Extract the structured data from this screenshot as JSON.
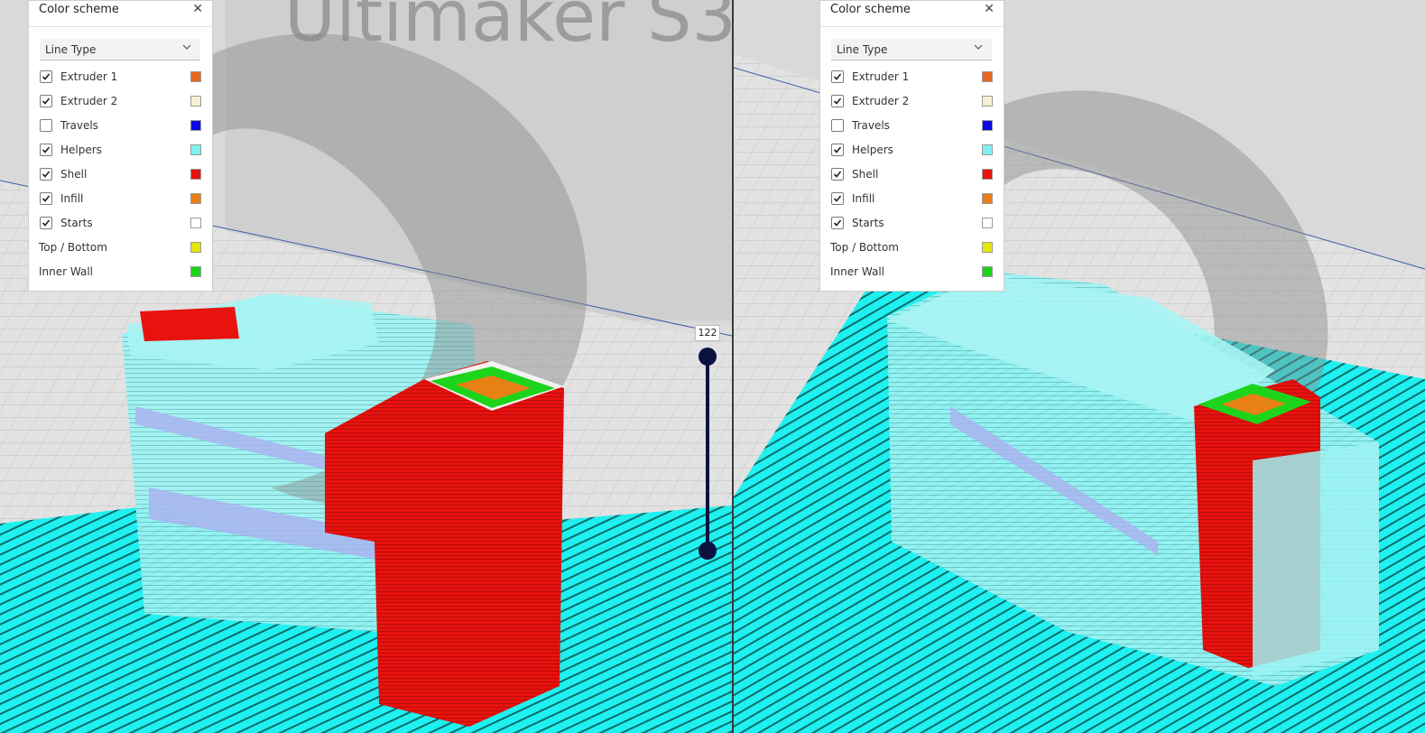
{
  "colors": {
    "panel_bg": "#ffffff",
    "slider": "#0c1240",
    "helpers": "#7ff0f0",
    "shell": "#e8120f",
    "inner_wall": "#1cd41c",
    "infill": "#e88016",
    "floor": "#e2e2e2"
  },
  "left": {
    "scene_brand": "Ultimaker S3",
    "panel": {
      "title": "Color scheme",
      "close_glyph": "✕",
      "dropdown_value": "Line Type",
      "rows": [
        {
          "label": "Extruder 1",
          "checked": true,
          "color": "#e8661e"
        },
        {
          "label": "Extruder 2",
          "checked": true,
          "color": "#f5f0d0"
        },
        {
          "label": "Travels",
          "checked": false,
          "color": "#0a0ae8"
        },
        {
          "label": "Helpers",
          "checked": true,
          "color": "#7ff0f0"
        },
        {
          "label": "Shell",
          "checked": true,
          "color": "#e8120f"
        },
        {
          "label": "Infill",
          "checked": true,
          "color": "#e88016"
        },
        {
          "label": "Starts",
          "checked": true,
          "color": "#ffffff"
        },
        {
          "label": "Top / Bottom",
          "checked": null,
          "color": "#e6e60c"
        },
        {
          "label": "Inner Wall",
          "checked": null,
          "color": "#1cd41c"
        }
      ]
    },
    "layer_slider": {
      "value": "122"
    }
  },
  "right": {
    "panel": {
      "title": "Color scheme",
      "close_glyph": "✕",
      "dropdown_value": "Line Type",
      "rows": [
        {
          "label": "Extruder 1",
          "checked": true,
          "color": "#e8661e"
        },
        {
          "label": "Extruder 2",
          "checked": true,
          "color": "#f5f0d0"
        },
        {
          "label": "Travels",
          "checked": false,
          "color": "#0a0ae8"
        },
        {
          "label": "Helpers",
          "checked": true,
          "color": "#7ff0f0"
        },
        {
          "label": "Shell",
          "checked": true,
          "color": "#e8120f"
        },
        {
          "label": "Infill",
          "checked": true,
          "color": "#e88016"
        },
        {
          "label": "Starts",
          "checked": true,
          "color": "#ffffff"
        },
        {
          "label": "Top / Bottom",
          "checked": null,
          "color": "#e6e60c"
        },
        {
          "label": "Inner Wall",
          "checked": null,
          "color": "#1cd41c"
        }
      ]
    }
  }
}
